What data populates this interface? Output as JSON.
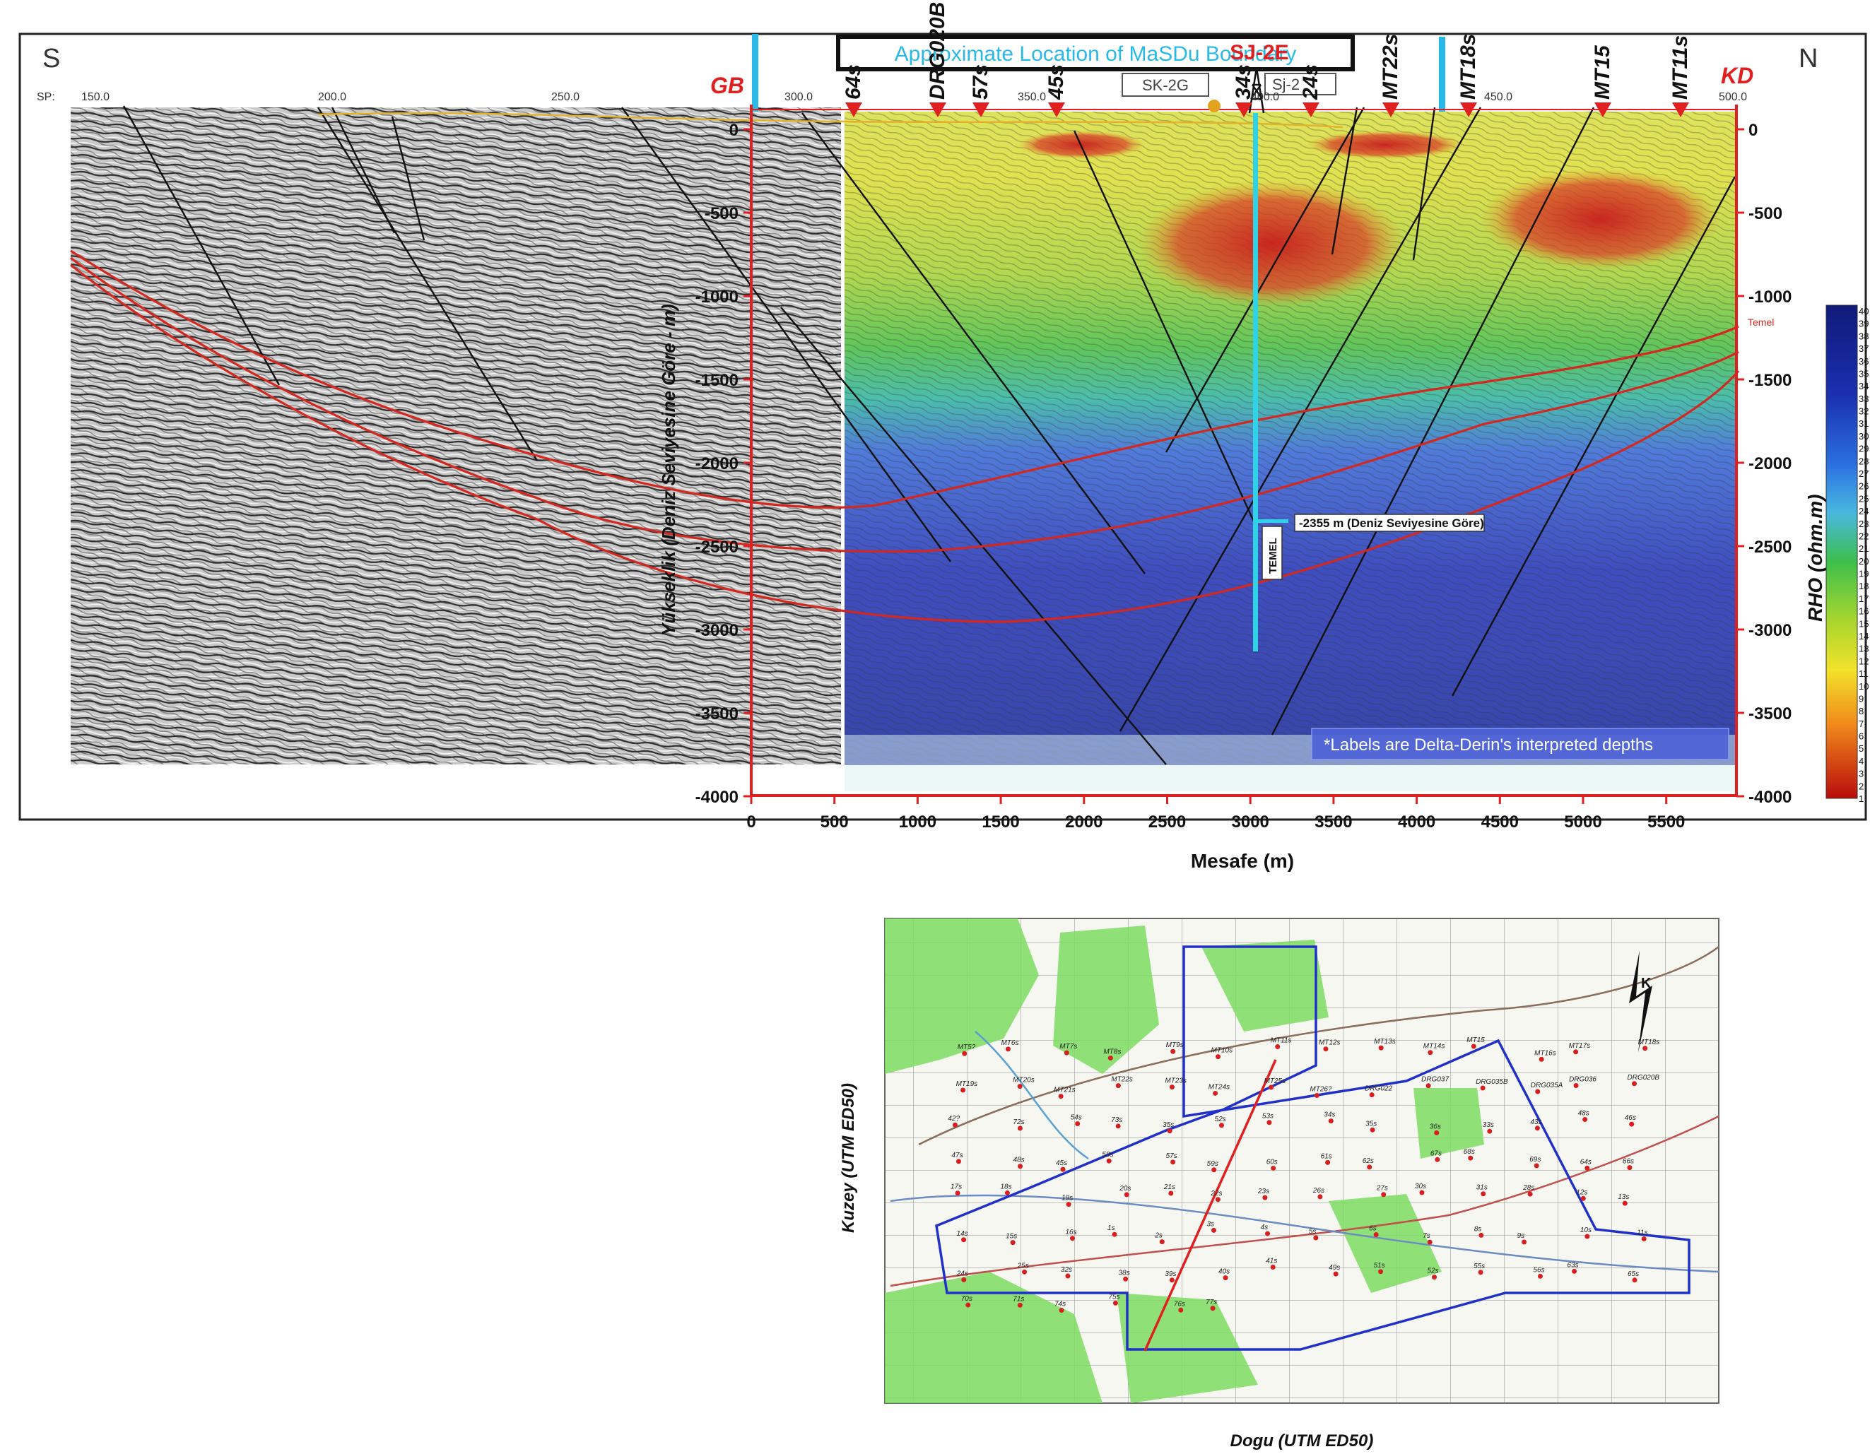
{
  "section": {
    "compass_left": "S",
    "compass_right": "N",
    "endpoint_left": "GB",
    "endpoint_right": "KD",
    "banner_text": "Approximate Location of MaSDu Boundary",
    "well_label": "SJ-2E",
    "well_boxes": [
      "SK-2G",
      "Sj-2"
    ],
    "sp_prefix": "SP:",
    "sp_labels": [
      "150.0",
      "200.0",
      "250.0",
      "300.0",
      "350.0",
      "400.0",
      "450.0",
      "500.0"
    ],
    "station_labels": [
      "64s",
      "DRG020B",
      "57s",
      "45s",
      "34s",
      "24s",
      "MT22s",
      "MT18s",
      "MT15",
      "MT11s"
    ],
    "y_label": "Yükseklik (Deniz Seviyesine Göre - m)",
    "x_label": "Mesafe (m)",
    "depth_ticks": [
      "0",
      "-500",
      "-1000",
      "-1500",
      "-2000",
      "-2500",
      "-3000",
      "-3500",
      "-4000"
    ],
    "distance_ticks": [
      "0",
      "500",
      "1000",
      "1500",
      "2000",
      "2500",
      "3000",
      "3500",
      "4000",
      "4500",
      "5000",
      "5500"
    ],
    "depth_annotation": "-2355 m (Deniz Seviyesine Göre)",
    "temel_label": "TEMEL",
    "temel_right": "Temel",
    "note": "*Labels are Delta-Derin's interpreted depths",
    "colorbar_title": "RHO (ohm.m)",
    "colorbar_ticks": [
      "40",
      "39",
      "38",
      "37",
      "36",
      "35",
      "34",
      "33",
      "32",
      "31",
      "30",
      "29",
      "28",
      "27",
      "26",
      "25",
      "24",
      "23",
      "22",
      "21",
      "20",
      "19",
      "18",
      "17",
      "16",
      "15",
      "14",
      "13",
      "12",
      "11",
      "10",
      "9",
      "8",
      "7",
      "6",
      "5",
      "4",
      "3",
      "2",
      "1"
    ]
  },
  "map": {
    "x_label": "Dogu (UTM ED50)",
    "y_label": "Kuzey (UTM ED50)",
    "north_label": "K",
    "station_labels": [
      "MT5?",
      "MT6s",
      "MT7s",
      "MT8s",
      "MT9s",
      "MT10s",
      "MT11s",
      "MT12s",
      "MT13s",
      "MT14s",
      "MT15",
      "MT16s",
      "MT17s",
      "MT18s",
      "MT19s",
      "MT20s",
      "MT21s",
      "MT22s",
      "MT23s",
      "MT24s",
      "MT25s",
      "MT26?",
      "DRG022",
      "DRG037",
      "DRG035B",
      "DRG035A",
      "DRG036",
      "DRG020B",
      "42?",
      "72s",
      "54s",
      "73s",
      "35s",
      "52s",
      "53s",
      "34s",
      "35s",
      "36s",
      "33s",
      "43s",
      "48s",
      "46s",
      "47s",
      "48s",
      "45s",
      "58s",
      "57s",
      "59s",
      "60s",
      "61s",
      "62s",
      "67s",
      "68s",
      "69s",
      "64s",
      "66s",
      "17s",
      "18s",
      "19s",
      "20s",
      "21s",
      "22s",
      "23s",
      "26s",
      "27s",
      "30s",
      "31s",
      "28s",
      "12s",
      "13s",
      "14s",
      "15s",
      "16s",
      "1s",
      "2s",
      "3s",
      "4s",
      "5s",
      "6s",
      "7s",
      "8s",
      "9s",
      "10s",
      "11s",
      "24s",
      "25s",
      "32s",
      "38s",
      "39s",
      "40s",
      "41s",
      "49s",
      "51s",
      "52s",
      "55s",
      "56s",
      "63s",
      "65s",
      "70s",
      "71s",
      "74s",
      "75s",
      "76s",
      "77s"
    ]
  }
}
